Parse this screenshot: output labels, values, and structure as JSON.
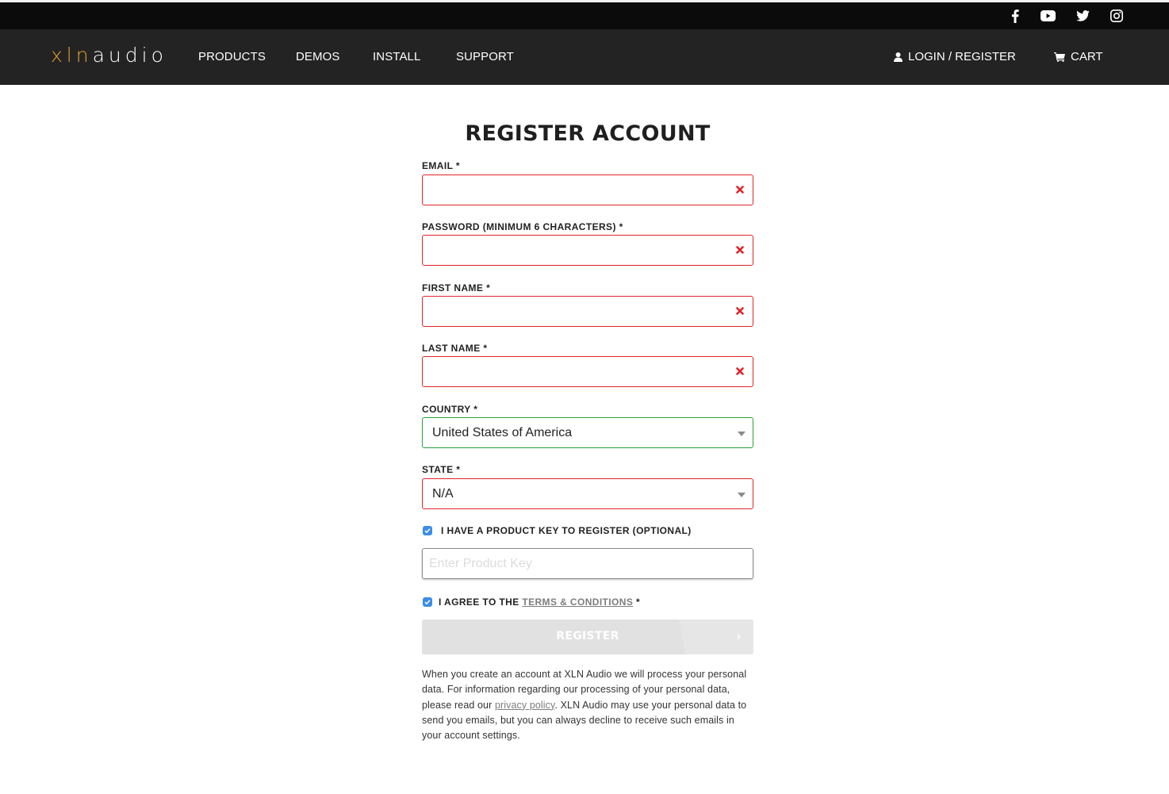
{
  "social": {
    "icons": [
      "facebook-icon",
      "youtube-icon",
      "twitter-icon",
      "instagram-icon"
    ]
  },
  "header": {
    "logo": {
      "part1": "xln",
      "part2": "audio"
    },
    "nav": [
      "PRODUCTS",
      "DEMOS",
      "INSTALL",
      "SUPPORT"
    ],
    "login_label": "LOGIN / REGISTER",
    "cart_label": "CART",
    "logo_accent_color": "#e8a033"
  },
  "form": {
    "title": "REGISTER ACCOUNT",
    "fields": {
      "email": {
        "label": "EMAIL *",
        "value": "",
        "status": "error"
      },
      "password": {
        "label": "PASSWORD (MINIMUM 6 CHARACTERS) *",
        "value": "",
        "status": "error"
      },
      "first_name": {
        "label": "FIRST NAME *",
        "value": "",
        "status": "error"
      },
      "last_name": {
        "label": "LAST NAME *",
        "value": "",
        "status": "error"
      }
    },
    "country": {
      "label": "COUNTRY *",
      "selected": "United States of America",
      "status": "valid"
    },
    "state": {
      "label": "STATE *",
      "selected": "N/A",
      "status": "error"
    },
    "product_key_checkbox": {
      "label": "I HAVE A PRODUCT KEY TO REGISTER (OPTIONAL)",
      "checked": true
    },
    "product_key": {
      "placeholder": "Enter Product Key",
      "value": ""
    },
    "terms_checkbox": {
      "prefix": "I AGREE TO THE ",
      "link": "TERMS & CONDITIONS",
      "suffix": " *",
      "checked": true
    },
    "register_button": "REGISTER",
    "privacy": {
      "before": "When you create an account at XLN Audio we will process your personal data. For information regarding our processing of your personal data, please read our ",
      "link": "privacy policy",
      "after": ". XLN Audio may use your personal data to send you emails, but you can always decline to receive such emails in your account settings."
    }
  },
  "colors": {
    "error": "#e3242b",
    "valid": "#27a33a",
    "checkbox": "#3b8ee8",
    "nav_bg": "#232323",
    "top_bg": "#0b0b0b"
  }
}
